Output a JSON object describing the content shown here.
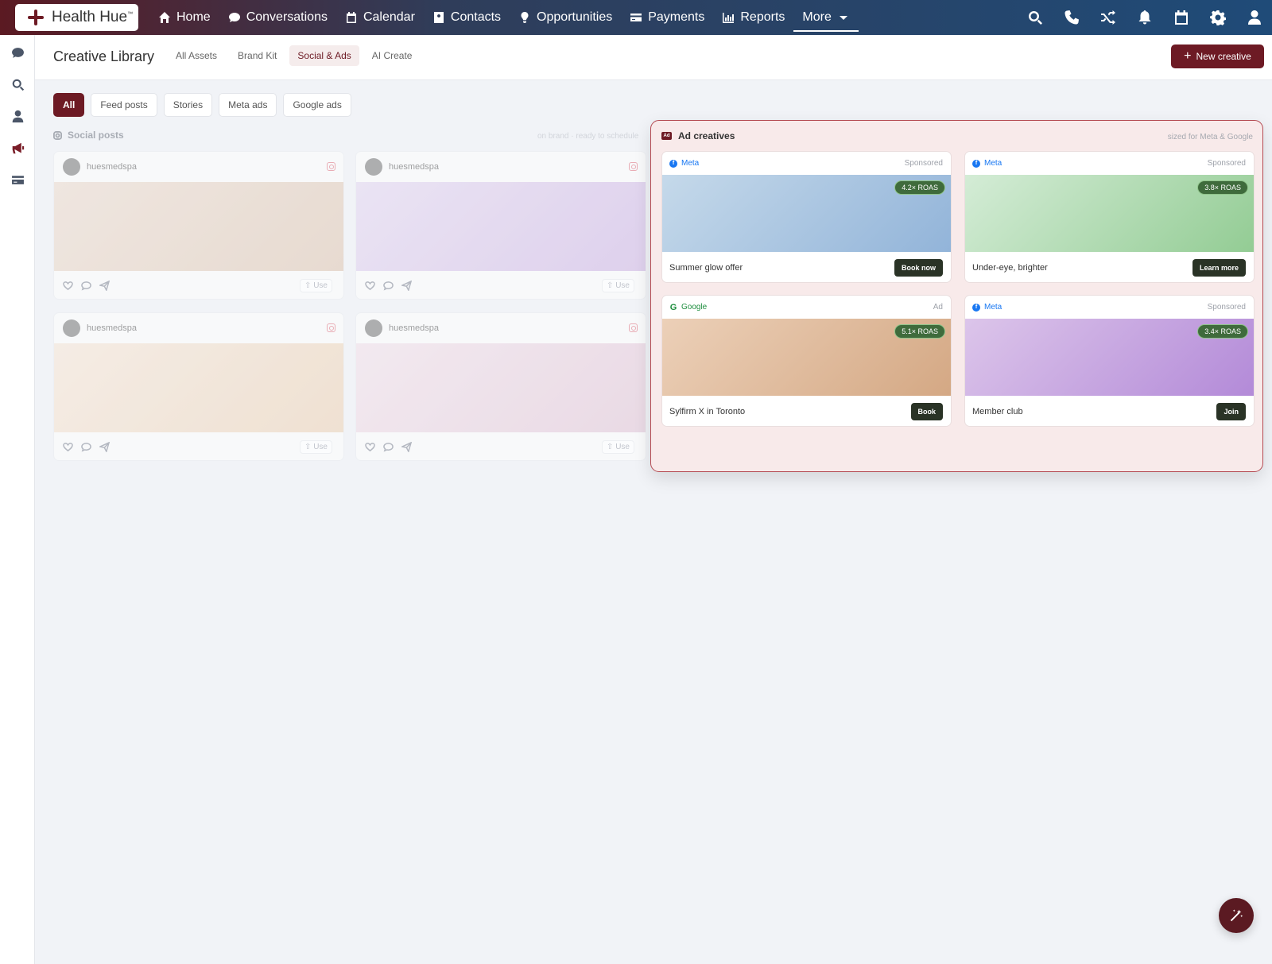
{
  "app": {
    "name": "Health Hue",
    "trademark": "™"
  },
  "nav": {
    "items": [
      {
        "label": "Home",
        "icon": "home-icon"
      },
      {
        "label": "Conversations",
        "icon": "chat-icon"
      },
      {
        "label": "Calendar",
        "icon": "calendar-icon"
      },
      {
        "label": "Contacts",
        "icon": "contact-card-icon"
      },
      {
        "label": "Opportunities",
        "icon": "lightbulb-icon"
      },
      {
        "label": "Payments",
        "icon": "credit-card-icon"
      },
      {
        "label": "Reports",
        "icon": "bar-chart-icon"
      },
      {
        "label": "More",
        "icon": "caret-down-icon"
      }
    ],
    "active": "More",
    "right_icons": [
      "search-icon",
      "phone-icon",
      "shuffle-icon",
      "bell-icon",
      "calendar-icon",
      "gear-icon",
      "user-icon"
    ]
  },
  "sidebar": {
    "icons": [
      "chat-icon",
      "search-icon",
      "user-icon",
      "megaphone-icon",
      "card-icon"
    ],
    "active": "megaphone-icon"
  },
  "header": {
    "title": "Creative Library",
    "tabs": [
      "All Assets",
      "Brand Kit",
      "Social & Ads",
      "AI Create"
    ],
    "active_tab": "Social & Ads",
    "new_button": "New creative"
  },
  "filters": {
    "chips": [
      "All",
      "Feed posts",
      "Stories",
      "Meta ads",
      "Google ads"
    ],
    "active": "All"
  },
  "social": {
    "title": "Social posts",
    "hint": "on brand · ready to schedule",
    "posts": [
      {
        "account": "huesmedspa",
        "use_label": "Use",
        "gradient": [
          "#efe3da",
          "#e5d4c6"
        ]
      },
      {
        "account": "huesmedspa",
        "use_label": "Use",
        "gradient": [
          "#e9e0f3",
          "#d9c7ea"
        ]
      },
      {
        "account": "huesmedspa",
        "use_label": "Use",
        "gradient": [
          "#f6ebe0",
          "#efdcc8"
        ]
      },
      {
        "account": "huesmedspa",
        "use_label": "Use",
        "gradient": [
          "#f3e7ee",
          "#e8d3e0"
        ]
      }
    ]
  },
  "ads": {
    "title": "Ad creatives",
    "hint": "sized for Meta & Google",
    "cards": [
      {
        "platform": "Meta",
        "label": "Sponsored",
        "roas": "4.2× ROAS",
        "headline": "Summer glow offer",
        "cta": "Book now",
        "gradient": [
          "#c5d9ea",
          "#92b4d9"
        ]
      },
      {
        "platform": "Meta",
        "label": "Sponsored",
        "roas": "3.8× ROAS",
        "headline": "Under-eye, brighter",
        "cta": "Learn more",
        "gradient": [
          "#d4ecd6",
          "#93cc94"
        ]
      },
      {
        "platform": "Google",
        "label": "Ad",
        "roas": "5.1× ROAS",
        "headline": "Sylfirm X in Toronto",
        "cta": "Book",
        "gradient": [
          "#ecd0b8",
          "#d4a884"
        ]
      },
      {
        "platform": "Meta",
        "label": "Sponsored",
        "roas": "3.4× ROAS",
        "headline": "Member club",
        "cta": "Join",
        "gradient": [
          "#dcc5ea",
          "#b38ad8"
        ]
      }
    ]
  },
  "colors": {
    "brand": "#6d1a24",
    "panel_border": "#b44a52",
    "roas_badge": "#3f6b3c",
    "cta": "#2a3326"
  }
}
